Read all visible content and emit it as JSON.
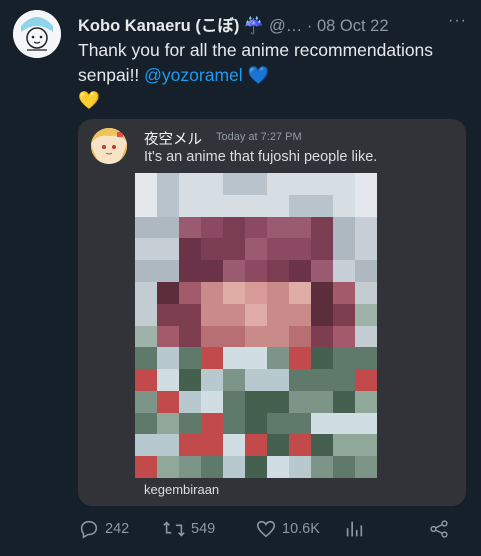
{
  "tweet": {
    "author_name": "Kobo Kanaeru (こぼ) ☔",
    "handle": " @…",
    "separator": " · ",
    "date": "08 Oct 22",
    "more_label": "···",
    "text_main": "Thank you for all the anime recommendations senpai!! ",
    "mention": "@yozoramel",
    "heart_blue": " 💙",
    "heart_yellow": "💛"
  },
  "embed": {
    "username": "夜空メル",
    "timestamp": "Today at 7:27 PM",
    "message": "It's an anime that fujoshi people like.",
    "caption": "kegembiraan"
  },
  "actions": {
    "replies": "242",
    "retweets": "549",
    "likes": "10.6K"
  },
  "colors": {
    "background": "#15202b",
    "accent": "#1d9bf0",
    "card": "#313338"
  }
}
